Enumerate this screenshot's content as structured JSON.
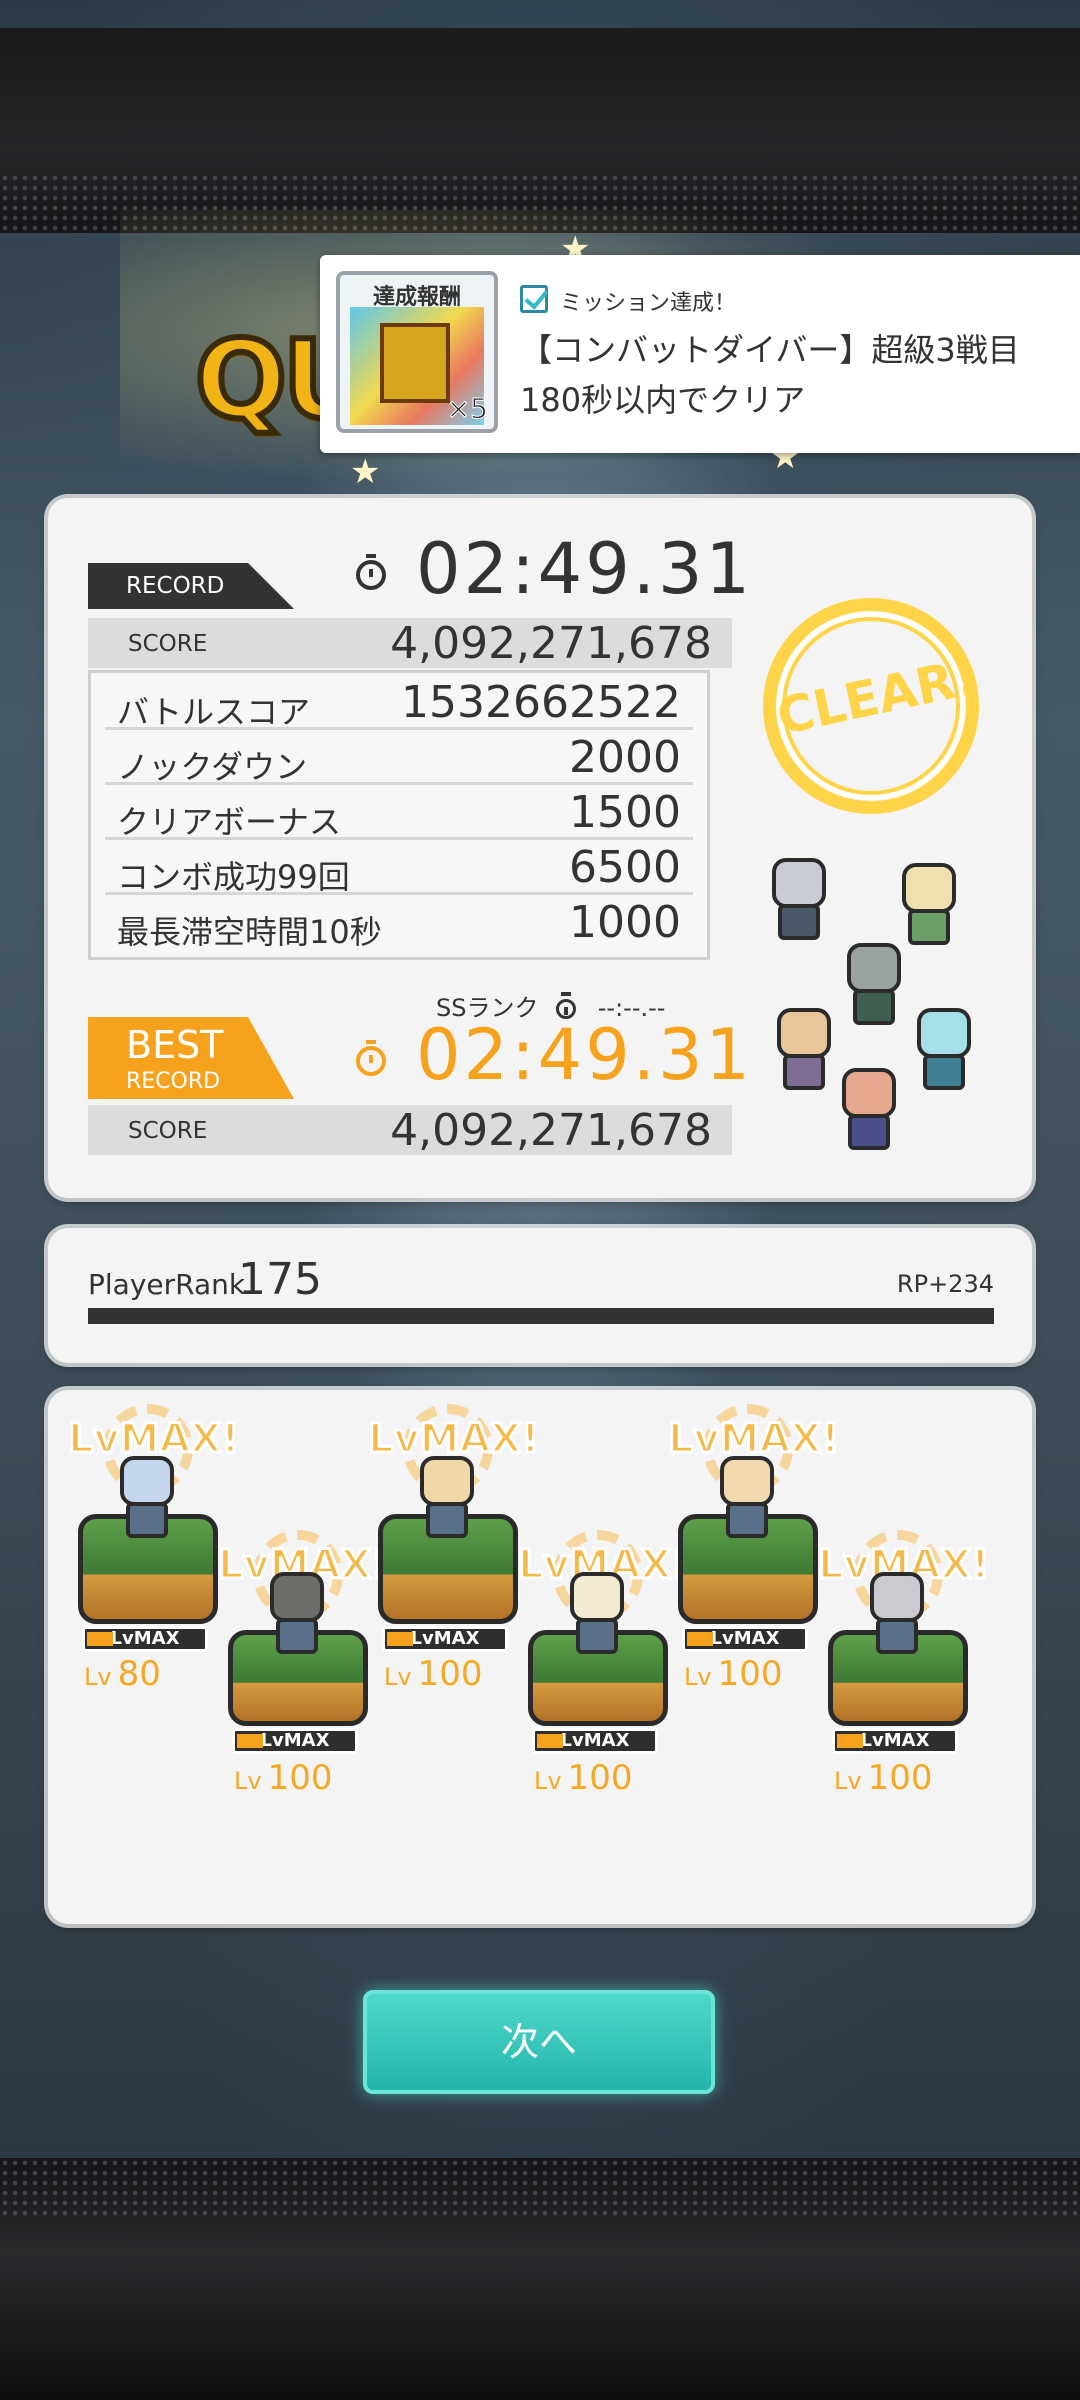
{
  "mission": {
    "reward_label": "達成報酬",
    "reward_count": "×5",
    "status": "ミッション達成！",
    "line1": "【コンバットダイバー】超級3戦目",
    "line2": "180秒以内でクリア"
  },
  "banner": {
    "logo_text": "QU"
  },
  "result": {
    "record_label": "RECORD",
    "record_time": "02:49.31",
    "score_label": "SCORE",
    "score_value": "4,092,271,678",
    "breakdown": [
      {
        "label": "バトルスコア",
        "value": "1532662522"
      },
      {
        "label": "ノックダウン",
        "value": "2000"
      },
      {
        "label": "クリアボーナス",
        "value": "1500"
      },
      {
        "label": "コンボ成功99回",
        "value": "6500"
      },
      {
        "label": "最長滞空時間10秒",
        "value": "1000"
      }
    ],
    "ss_rank_label": "SSランク",
    "ss_rank_time": "--:--.--",
    "best_label_1": "BEST",
    "best_label_2": "RECORD",
    "best_time": "02:49.31",
    "best_score_label": "SCORE",
    "best_score_value": "4,092,271,678",
    "clear_stamp": "CLEAR!"
  },
  "player": {
    "rank_label": "PlayerRank",
    "rank_value": "175",
    "rp": "RP+234",
    "progress": 0
  },
  "units": [
    {
      "badge": "LvMAX!",
      "tag": "LvMAX",
      "lv_prefix": "Lv",
      "level": "80"
    },
    {
      "badge": "LvMAX!",
      "tag": "LvMAX",
      "lv_prefix": "Lv",
      "level": "100"
    },
    {
      "badge": "LvMAX!",
      "tag": "LvMAX",
      "lv_prefix": "Lv",
      "level": "100"
    },
    {
      "badge": "LvMAX!",
      "tag": "LvMAX",
      "lv_prefix": "Lv",
      "level": "100"
    },
    {
      "badge": "LvMAX!",
      "tag": "LvMAX",
      "lv_prefix": "Lv",
      "level": "100"
    },
    {
      "badge": "LvMAX!",
      "tag": "LvMAX",
      "lv_prefix": "Lv",
      "level": "100"
    }
  ],
  "next_button": "次へ",
  "colors": {
    "accent_orange": "#f6a21d",
    "clear_yellow": "#ffd449",
    "button_teal": "#2ec4b9"
  }
}
